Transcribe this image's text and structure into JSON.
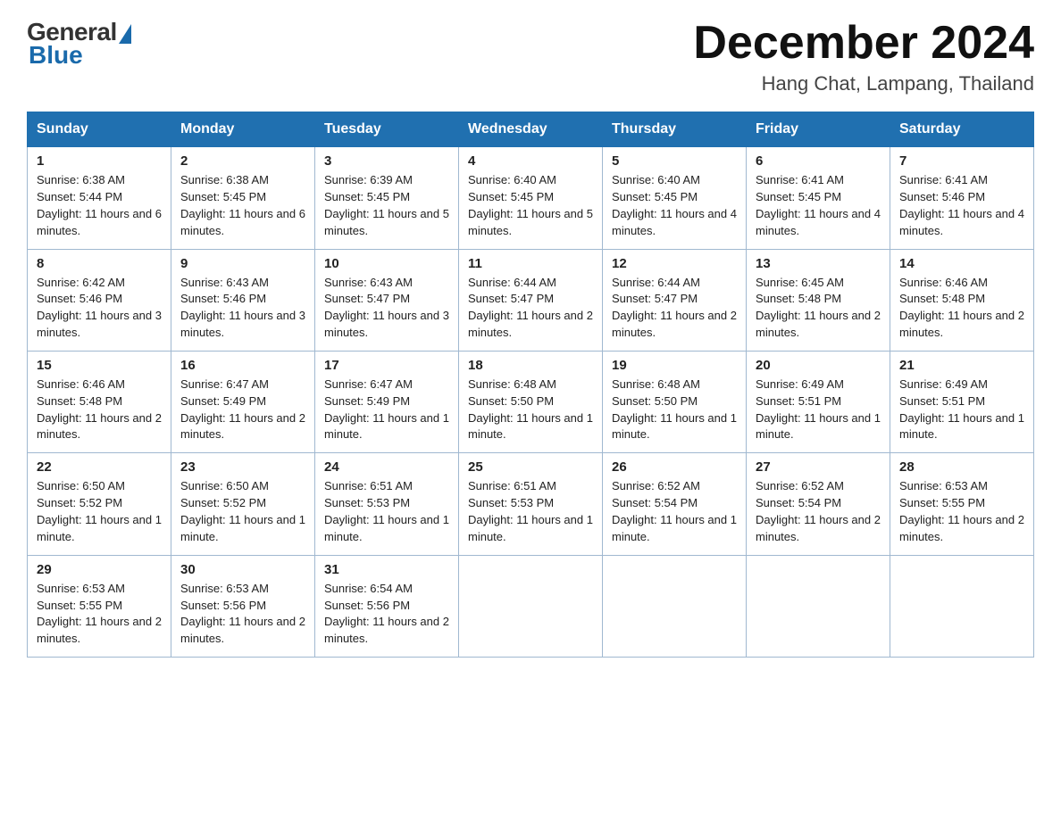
{
  "logo": {
    "general": "General",
    "blue": "Blue"
  },
  "header": {
    "month": "December 2024",
    "location": "Hang Chat, Lampang, Thailand"
  },
  "days_of_week": [
    "Sunday",
    "Monday",
    "Tuesday",
    "Wednesday",
    "Thursday",
    "Friday",
    "Saturday"
  ],
  "weeks": [
    [
      {
        "day": "1",
        "sunrise": "6:38 AM",
        "sunset": "5:44 PM",
        "daylight": "11 hours and 6 minutes."
      },
      {
        "day": "2",
        "sunrise": "6:38 AM",
        "sunset": "5:45 PM",
        "daylight": "11 hours and 6 minutes."
      },
      {
        "day": "3",
        "sunrise": "6:39 AM",
        "sunset": "5:45 PM",
        "daylight": "11 hours and 5 minutes."
      },
      {
        "day": "4",
        "sunrise": "6:40 AM",
        "sunset": "5:45 PM",
        "daylight": "11 hours and 5 minutes."
      },
      {
        "day": "5",
        "sunrise": "6:40 AM",
        "sunset": "5:45 PM",
        "daylight": "11 hours and 4 minutes."
      },
      {
        "day": "6",
        "sunrise": "6:41 AM",
        "sunset": "5:45 PM",
        "daylight": "11 hours and 4 minutes."
      },
      {
        "day": "7",
        "sunrise": "6:41 AM",
        "sunset": "5:46 PM",
        "daylight": "11 hours and 4 minutes."
      }
    ],
    [
      {
        "day": "8",
        "sunrise": "6:42 AM",
        "sunset": "5:46 PM",
        "daylight": "11 hours and 3 minutes."
      },
      {
        "day": "9",
        "sunrise": "6:43 AM",
        "sunset": "5:46 PM",
        "daylight": "11 hours and 3 minutes."
      },
      {
        "day": "10",
        "sunrise": "6:43 AM",
        "sunset": "5:47 PM",
        "daylight": "11 hours and 3 minutes."
      },
      {
        "day": "11",
        "sunrise": "6:44 AM",
        "sunset": "5:47 PM",
        "daylight": "11 hours and 2 minutes."
      },
      {
        "day": "12",
        "sunrise": "6:44 AM",
        "sunset": "5:47 PM",
        "daylight": "11 hours and 2 minutes."
      },
      {
        "day": "13",
        "sunrise": "6:45 AM",
        "sunset": "5:48 PM",
        "daylight": "11 hours and 2 minutes."
      },
      {
        "day": "14",
        "sunrise": "6:46 AM",
        "sunset": "5:48 PM",
        "daylight": "11 hours and 2 minutes."
      }
    ],
    [
      {
        "day": "15",
        "sunrise": "6:46 AM",
        "sunset": "5:48 PM",
        "daylight": "11 hours and 2 minutes."
      },
      {
        "day": "16",
        "sunrise": "6:47 AM",
        "sunset": "5:49 PM",
        "daylight": "11 hours and 2 minutes."
      },
      {
        "day": "17",
        "sunrise": "6:47 AM",
        "sunset": "5:49 PM",
        "daylight": "11 hours and 1 minute."
      },
      {
        "day": "18",
        "sunrise": "6:48 AM",
        "sunset": "5:50 PM",
        "daylight": "11 hours and 1 minute."
      },
      {
        "day": "19",
        "sunrise": "6:48 AM",
        "sunset": "5:50 PM",
        "daylight": "11 hours and 1 minute."
      },
      {
        "day": "20",
        "sunrise": "6:49 AM",
        "sunset": "5:51 PM",
        "daylight": "11 hours and 1 minute."
      },
      {
        "day": "21",
        "sunrise": "6:49 AM",
        "sunset": "5:51 PM",
        "daylight": "11 hours and 1 minute."
      }
    ],
    [
      {
        "day": "22",
        "sunrise": "6:50 AM",
        "sunset": "5:52 PM",
        "daylight": "11 hours and 1 minute."
      },
      {
        "day": "23",
        "sunrise": "6:50 AM",
        "sunset": "5:52 PM",
        "daylight": "11 hours and 1 minute."
      },
      {
        "day": "24",
        "sunrise": "6:51 AM",
        "sunset": "5:53 PM",
        "daylight": "11 hours and 1 minute."
      },
      {
        "day": "25",
        "sunrise": "6:51 AM",
        "sunset": "5:53 PM",
        "daylight": "11 hours and 1 minute."
      },
      {
        "day": "26",
        "sunrise": "6:52 AM",
        "sunset": "5:54 PM",
        "daylight": "11 hours and 1 minute."
      },
      {
        "day": "27",
        "sunrise": "6:52 AM",
        "sunset": "5:54 PM",
        "daylight": "11 hours and 2 minutes."
      },
      {
        "day": "28",
        "sunrise": "6:53 AM",
        "sunset": "5:55 PM",
        "daylight": "11 hours and 2 minutes."
      }
    ],
    [
      {
        "day": "29",
        "sunrise": "6:53 AM",
        "sunset": "5:55 PM",
        "daylight": "11 hours and 2 minutes."
      },
      {
        "day": "30",
        "sunrise": "6:53 AM",
        "sunset": "5:56 PM",
        "daylight": "11 hours and 2 minutes."
      },
      {
        "day": "31",
        "sunrise": "6:54 AM",
        "sunset": "5:56 PM",
        "daylight": "11 hours and 2 minutes."
      },
      null,
      null,
      null,
      null
    ]
  ],
  "labels": {
    "sunrise": "Sunrise:",
    "sunset": "Sunset:",
    "daylight": "Daylight:"
  }
}
